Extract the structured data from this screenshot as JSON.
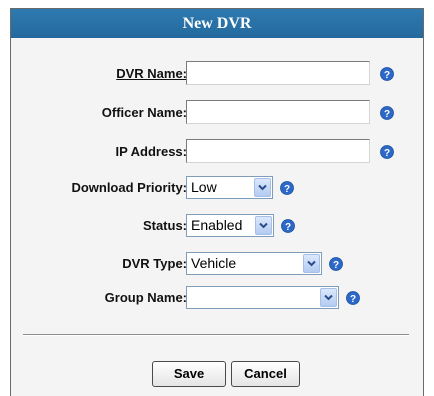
{
  "dialog": {
    "title": "New DVR"
  },
  "form": {
    "dvr_name": {
      "label": "DVR Name:",
      "value": ""
    },
    "officer_name": {
      "label": "Officer Name:",
      "value": ""
    },
    "ip_address": {
      "label": "IP Address:",
      "value": ""
    },
    "download_priority": {
      "label": "Download Priority:",
      "selected": "Low"
    },
    "status": {
      "label": "Status:",
      "selected": "Enabled"
    },
    "dvr_type": {
      "label": "DVR Type:",
      "selected": "Vehicle"
    },
    "group_name": {
      "label": "Group Name:",
      "selected": ""
    }
  },
  "buttons": {
    "save": "Save",
    "cancel": "Cancel"
  },
  "icons": {
    "help": "help-icon",
    "dropdown": "chevron-down-icon"
  },
  "colors": {
    "title_bar": "#2673a9",
    "help_icon": "#2c68c8",
    "dialog_bg": "#f4f4f4"
  }
}
